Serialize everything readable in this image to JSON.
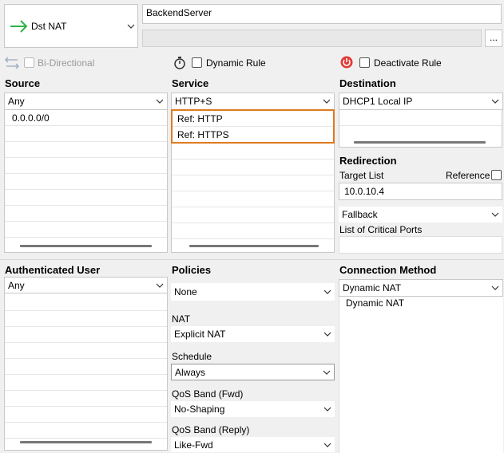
{
  "rule": {
    "type_label": "Dst NAT",
    "name": "BackendServer",
    "description": "",
    "more_button": "..."
  },
  "options": {
    "bidirectional": "Bi-Directional",
    "dynamic_rule": "Dynamic Rule",
    "deactivate_rule": "Deactivate Rule"
  },
  "source": {
    "header": "Source",
    "selected": "Any",
    "items": [
      "0.0.0.0/0"
    ]
  },
  "service": {
    "header": "Service",
    "selected": "HTTP+S",
    "items": [
      "Ref: HTTP",
      "Ref: HTTPS"
    ]
  },
  "destination": {
    "header": "Destination",
    "selected": "DHCP1 Local IP"
  },
  "redirection": {
    "header": "Redirection",
    "target_list_label": "Target List",
    "reference_label": "Reference",
    "target_value": "10.0.10.4",
    "fallback": "Fallback",
    "critical_ports_label": "List of Critical Ports"
  },
  "auth_user": {
    "header": "Authenticated User",
    "selected": "Any"
  },
  "policies": {
    "header": "Policies",
    "policy_value": "None",
    "nat_label": "NAT",
    "nat_value": "Explicit NAT",
    "schedule_label": "Schedule",
    "schedule_value": "Always",
    "qos_fwd_label": "QoS Band (Fwd)",
    "qos_fwd_value": "No-Shaping",
    "qos_reply_label": "QoS Band (Reply)",
    "qos_reply_value": "Like-Fwd"
  },
  "connection": {
    "header": "Connection Method",
    "selected": "Dynamic NAT",
    "items": [
      "Dynamic NAT"
    ]
  },
  "colors": {
    "accent_orange": "#e07a1f",
    "arrow_green": "#2fb34a",
    "power_red": "#e53935"
  }
}
